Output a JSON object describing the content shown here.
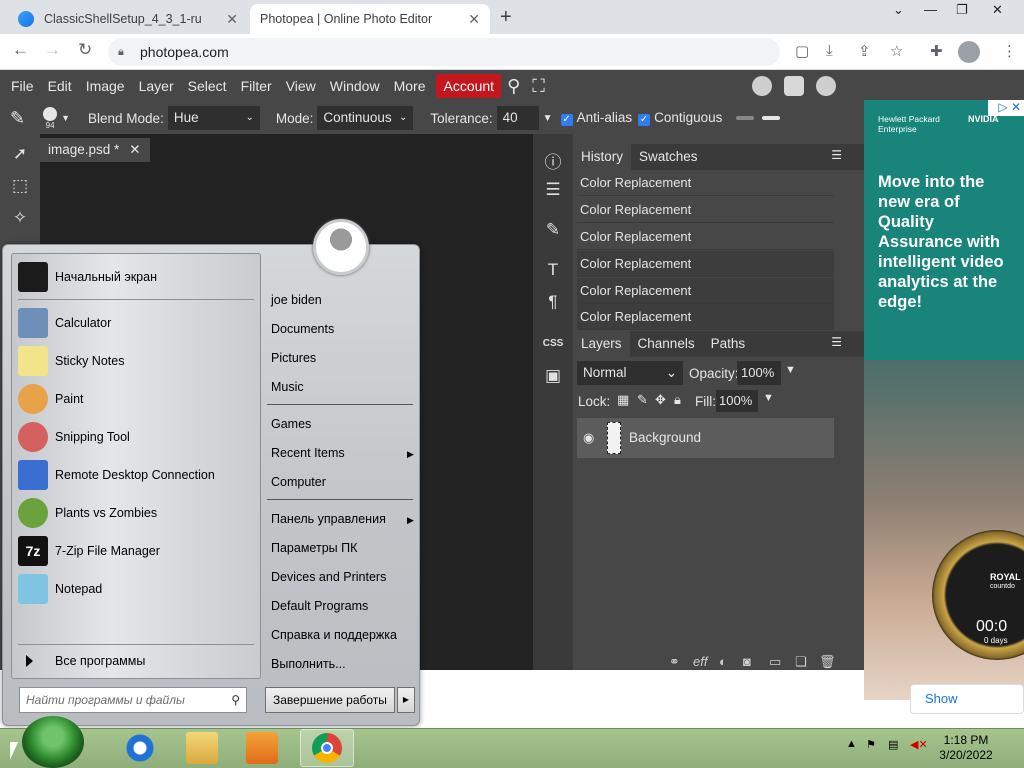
{
  "browser": {
    "tabs": [
      {
        "title": "ClassicShellSetup_4_3_1-ru"
      },
      {
        "title": "Photopea | Online Photo Editor"
      }
    ],
    "new_tab": "+",
    "url": "photopea.com"
  },
  "photopea": {
    "menu": [
      "File",
      "Edit",
      "Image",
      "Layer",
      "Select",
      "Filter",
      "View",
      "Window",
      "More",
      "Account"
    ],
    "options": {
      "brush_size": "94",
      "blend_mode_label": "Blend Mode:",
      "blend_mode_value": "Hue",
      "mode_label": "Mode:",
      "mode_value": "Continuous",
      "tolerance_label": "Tolerance:",
      "tolerance_value": "40",
      "anti_alias": "Anti-alias",
      "contiguous": "Contiguous"
    },
    "doc_tab": "image.psd *",
    "history_tabs": [
      "History",
      "Swatches"
    ],
    "history_items": [
      "Color Replacement",
      "Color Replacement",
      "Color Replacement",
      "Color Replacement",
      "Color Replacement",
      "Color Replacement"
    ],
    "layer_tabs": [
      "Layers",
      "Channels",
      "Paths"
    ],
    "blend": "Normal",
    "opacity_label": "Opacity:",
    "opacity_value": "100%",
    "lock_label": "Lock:",
    "fill_label": "Fill:",
    "fill_value": "100%",
    "layer_name": "Background",
    "side_label_css": "CSS"
  },
  "ad": {
    "brand": "Hewlett Packard Enterprise",
    "partner": "NVIDIA",
    "headline": "Move into the new era of Quality Assurance with intelligent video analytics at the edge!",
    "watch_text": "ROYAL",
    "watch_sub": "countdo",
    "watch_time": "00:0",
    "watch_days": "0 days",
    "show_button": "Show"
  },
  "start_menu": {
    "programs": [
      {
        "label": "Начальный экран",
        "color": "#1b1b1b"
      },
      {
        "label": "Calculator",
        "color": "#6d8fb8"
      },
      {
        "label": "Sticky Notes",
        "color": "#f2e48a"
      },
      {
        "label": "Paint",
        "color": "#e8a24a"
      },
      {
        "label": "Snipping Tool",
        "color": "#d46060"
      },
      {
        "label": "Remote Desktop Connection",
        "color": "#3a6fd0"
      },
      {
        "label": "Plants vs Zombies",
        "color": "#6aa33d"
      },
      {
        "label": "7-Zip File Manager",
        "color": "#111111"
      },
      {
        "label": "Notepad",
        "color": "#7fc4e0"
      }
    ],
    "all_programs": "Все программы",
    "search_placeholder": "Найти программы и файлы",
    "right_links": [
      "joe biden",
      "Documents",
      "Pictures",
      "Music",
      "Games",
      "Recent Items",
      "Computer",
      "Панель управления",
      "Параметры ПК",
      "Devices and Printers",
      "Default Programs",
      "Справка и поддержка",
      "Выполнить..."
    ],
    "shutdown": "Завершение работы"
  },
  "taskbar": {
    "time": "1:18 PM",
    "date": "3/20/2022"
  }
}
